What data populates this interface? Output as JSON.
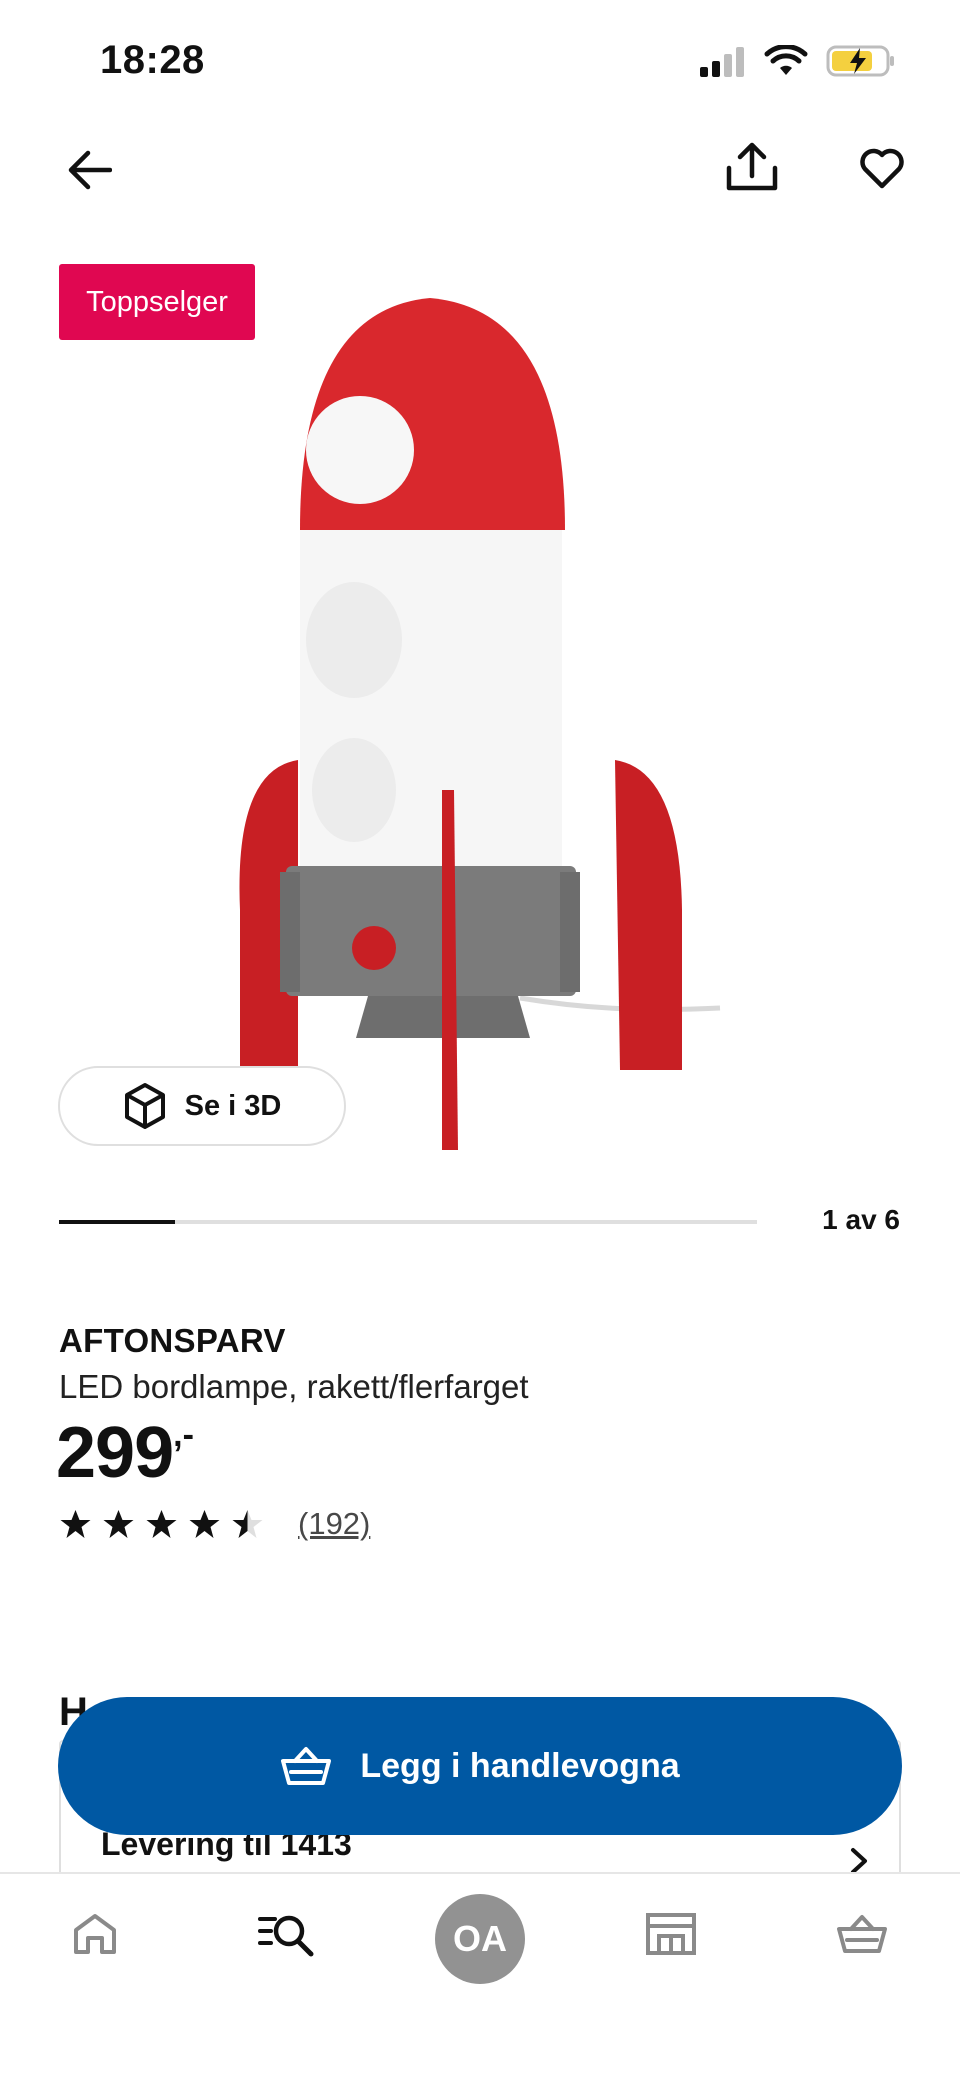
{
  "status_bar": {
    "time": "18:28"
  },
  "nav": {
    "back_icon": "arrow-left-icon",
    "share_icon": "share-icon",
    "favourite_icon": "heart-icon"
  },
  "product": {
    "badge": "Toppselger",
    "view_3d_label": "Se i 3D",
    "carousel": {
      "counter": "1 av 6",
      "current": 1,
      "total": 6
    },
    "name": "AFTONSPARV",
    "description": "LED bordlampe, rakett/flerfarget",
    "price_integer": "299",
    "price_decimal": ",-",
    "rating": {
      "value": 4.5,
      "max": 5,
      "review_count": "(192)"
    }
  },
  "delivery": {
    "heading_partial": "H",
    "title": "Levering til 1413"
  },
  "cta": {
    "label": "Legg i handlevogna"
  },
  "tab_bar": {
    "tabs": [
      {
        "name": "home",
        "icon": "home-icon"
      },
      {
        "name": "search",
        "icon": "search-list-icon"
      },
      {
        "name": "profile",
        "avatar": "OA"
      },
      {
        "name": "store",
        "icon": "store-icon"
      },
      {
        "name": "cart",
        "icon": "basket-icon"
      }
    ]
  },
  "colors": {
    "badge": "#e00751",
    "primary": "#0058a3",
    "avatar": "#929292"
  }
}
